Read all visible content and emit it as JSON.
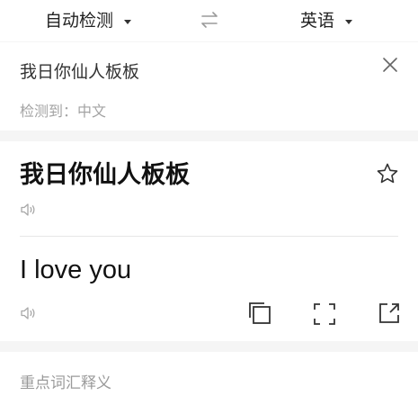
{
  "language_bar": {
    "source_language": "自动检测",
    "target_language": "英语",
    "swap_icon": "swap-arrows-icon"
  },
  "input": {
    "text": "我日你仙人板板",
    "detected_label": "检测到：中文",
    "close_icon": "close-icon"
  },
  "result": {
    "source_text": "我日你仙人板板",
    "translation": "I love you",
    "icons": [
      "star-icon",
      "speaker-icon",
      "copy-icon",
      "fullscreen-icon",
      "share-icon"
    ]
  },
  "vocabulary": {
    "title": "重点词汇释义"
  }
}
